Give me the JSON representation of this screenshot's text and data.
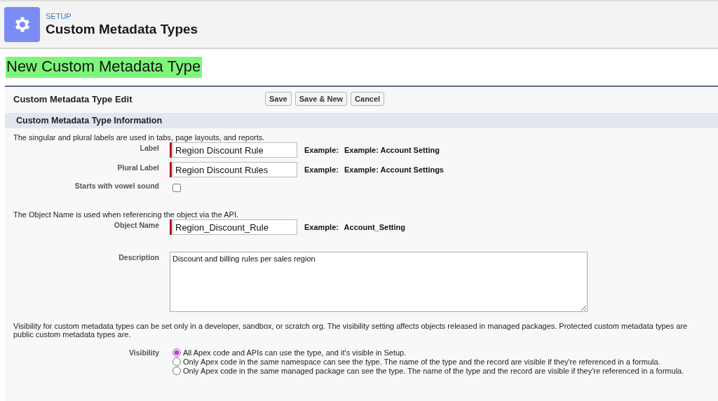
{
  "header": {
    "eyebrow": "SETUP",
    "title": "Custom Metadata Types"
  },
  "page_title": "New Custom Metadata Type",
  "edit_block": {
    "title": "Custom Metadata Type Edit",
    "buttons": [
      "Save",
      "Save & New",
      "Cancel"
    ]
  },
  "section": {
    "title": "Custom Metadata Type Information"
  },
  "rows": [
    {
      "kind": "note",
      "text": "The singular and plural labels are used in tabs, page layouts, and reports."
    },
    {
      "kind": "input",
      "label": "Label",
      "value": "Region Discount Rule",
      "required": true,
      "example_label": "Example:",
      "example": "Example: Account Setting"
    },
    {
      "kind": "input",
      "label": "Plural Label",
      "value": "Region Discount Rules",
      "required": true,
      "example_label": "Example:",
      "example": "Example: Account Settings"
    },
    {
      "kind": "checkbox",
      "label": "Starts with vowel sound",
      "checked": false
    },
    {
      "kind": "note",
      "text": "The Object Name is used when referencing the object via the API."
    },
    {
      "kind": "input",
      "label": "Object Name",
      "value": "Region_Discount_Rule",
      "required": true,
      "example_label": "Example:",
      "example": "Account_Setting"
    },
    {
      "kind": "textarea",
      "label": "Description",
      "value": "Discount and billing rules per sales region"
    },
    {
      "kind": "note",
      "lines": [
        "Visibility for custom metadata types can be set only in a developer, sandbox, or scratch org. The visibility setting affects objects released in managed packages. Protected custom metadata types are",
        "public custom metadata types are."
      ]
    },
    {
      "kind": "radio",
      "label": "Visibility",
      "options": [
        {
          "label": "All Apex code and APIs can use the type, and it's visible in Setup.",
          "selected": true
        },
        {
          "label": "Only Apex code in the same namespace can see the type. The name of the type and the record are visible if they're referenced in a formula.",
          "selected": false
        },
        {
          "label": "Only Apex code in the same managed package can see the type. The name of the type and the record are visible if they're referenced in a formula.",
          "selected": false
        }
      ]
    }
  ]
}
